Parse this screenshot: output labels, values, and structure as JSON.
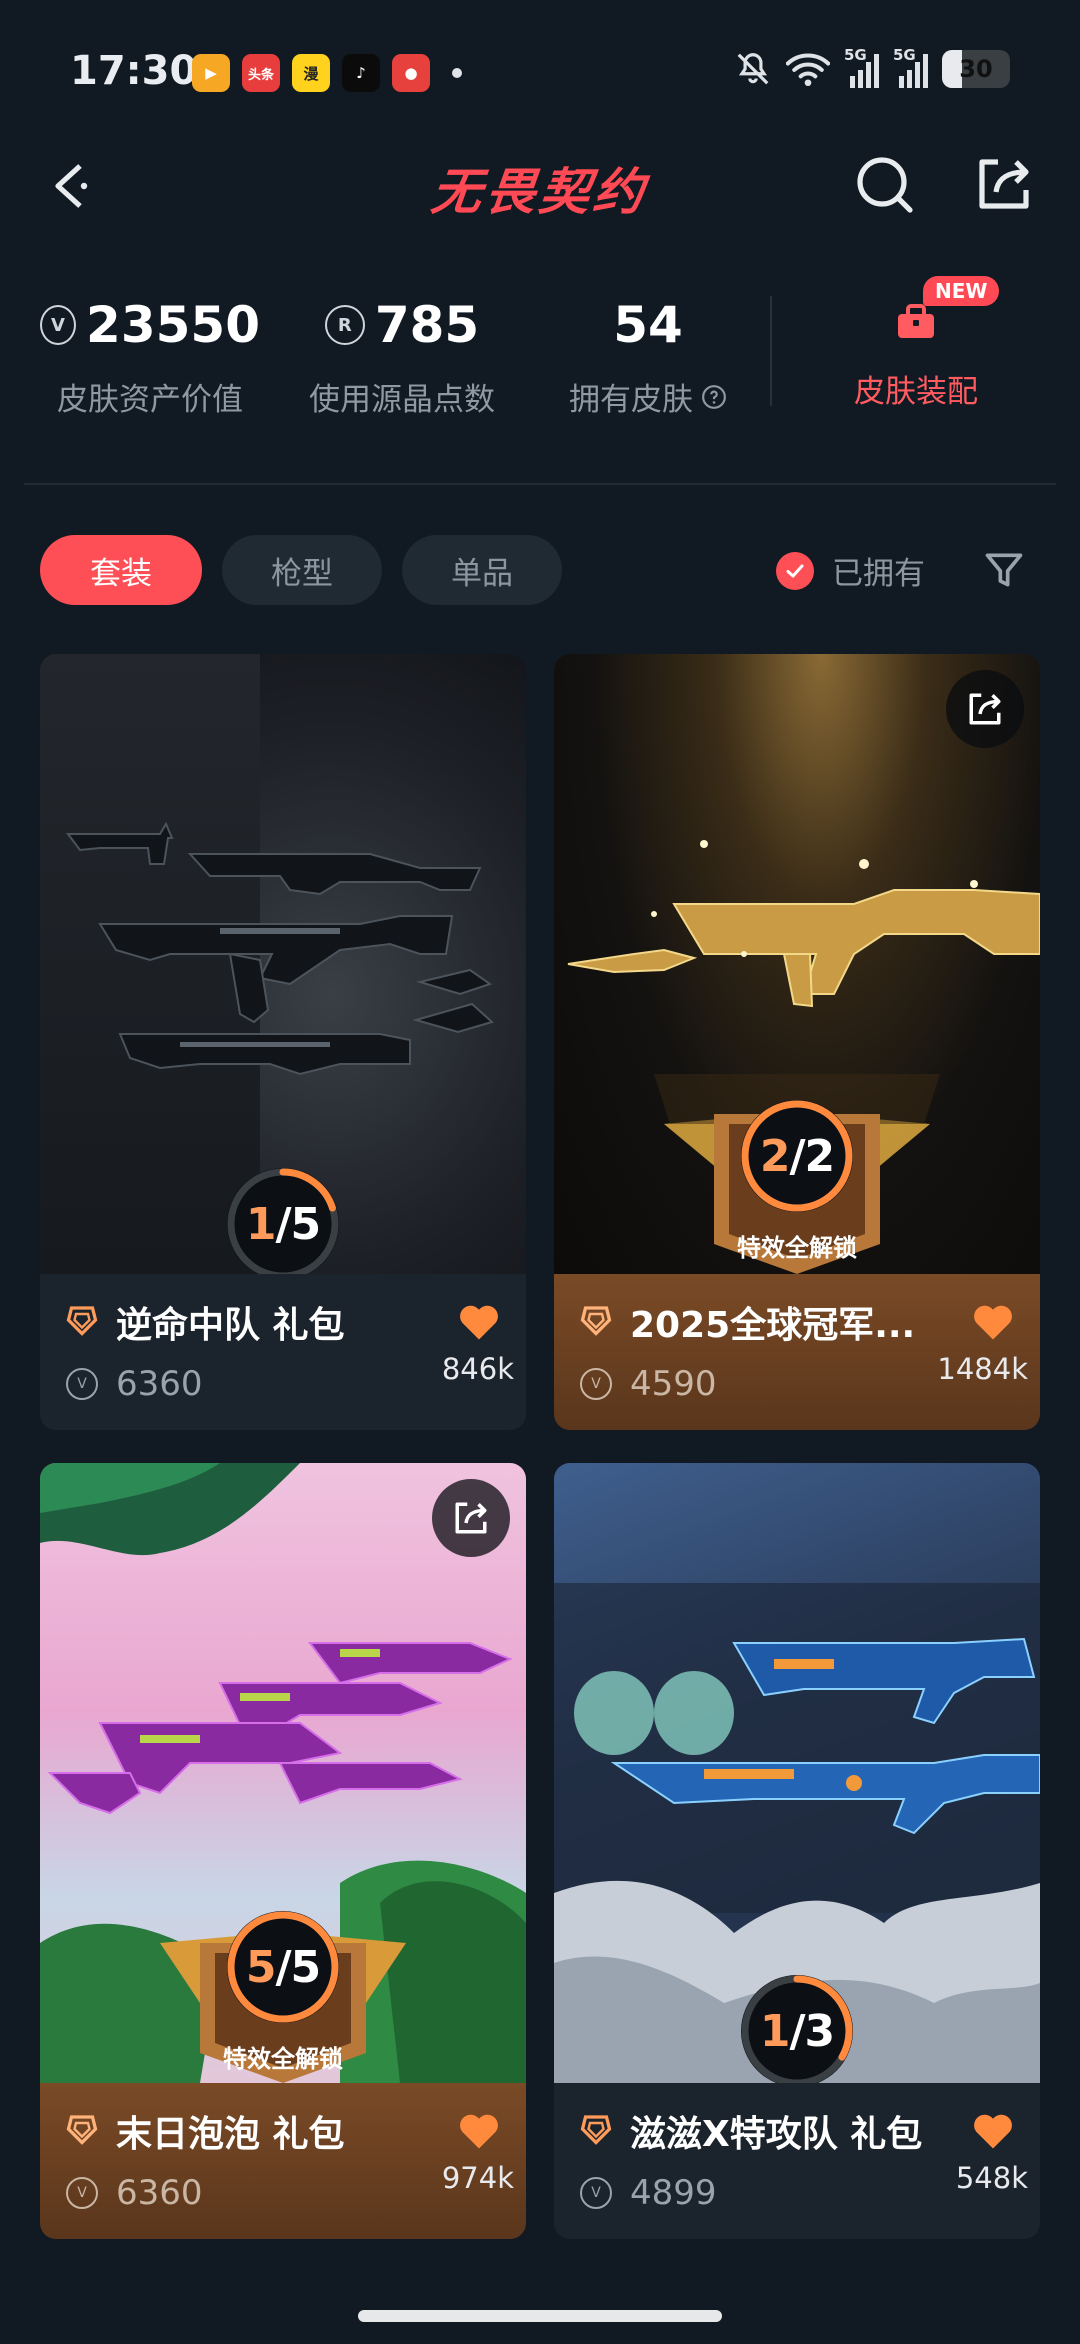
{
  "status_bar": {
    "time": "17:30",
    "battery": "30",
    "signal_labels": [
      "5G",
      "5G"
    ],
    "apps": [
      {
        "name": "video-app-icon",
        "label": "▶",
        "color": "#f6a724"
      },
      {
        "name": "toutiao-icon",
        "label": "头条",
        "color": "#e83d3d"
      },
      {
        "name": "bilibili-cartoon-icon",
        "label": "漫",
        "color": "#ffd21e"
      },
      {
        "name": "tiktok-icon",
        "label": "♪",
        "color": "#0b0b0b"
      },
      {
        "name": "pig-app-icon",
        "label": "●",
        "color": "#e6413d"
      }
    ]
  },
  "header": {
    "title": "无畏契约"
  },
  "stats": [
    {
      "value": "23550",
      "label": "皮肤资产价值",
      "icon": "V"
    },
    {
      "value": "785",
      "label": "使用源晶点数",
      "icon": "R"
    },
    {
      "value": "54",
      "label": "拥有皮肤"
    }
  ],
  "equip": {
    "label": "皮肤装配",
    "badge": "NEW"
  },
  "tabs": [
    {
      "label": "套装",
      "active": true
    },
    {
      "label": "枪型",
      "active": false
    },
    {
      "label": "单品",
      "active": false
    }
  ],
  "owned_filter": {
    "label": "已拥有",
    "checked": true
  },
  "cards": [
    {
      "title": "逆命中队 礼包",
      "price": "6360",
      "likes": "846k",
      "progress": "1/5",
      "collected": 1,
      "total": 5,
      "unlocked": false
    },
    {
      "title": "2025全球冠军...",
      "price": "4590",
      "likes": "1484k",
      "progress": "2/2",
      "collected": 2,
      "total": 2,
      "unlocked": true,
      "unlock_label": "特效全解锁"
    },
    {
      "title": "末日泡泡 礼包",
      "price": "6360",
      "likes": "974k",
      "progress": "5/5",
      "collected": 5,
      "total": 5,
      "unlocked": true,
      "unlock_label": "特效全解锁"
    },
    {
      "title": "滋滋X特攻队 礼包",
      "price": "4899",
      "likes": "548k",
      "progress": "1/3",
      "collected": 1,
      "total": 3,
      "unlocked": false
    }
  ],
  "colors": {
    "accent": "#ff4f56",
    "progress": "#ff8a3d",
    "background": "#111a22"
  }
}
